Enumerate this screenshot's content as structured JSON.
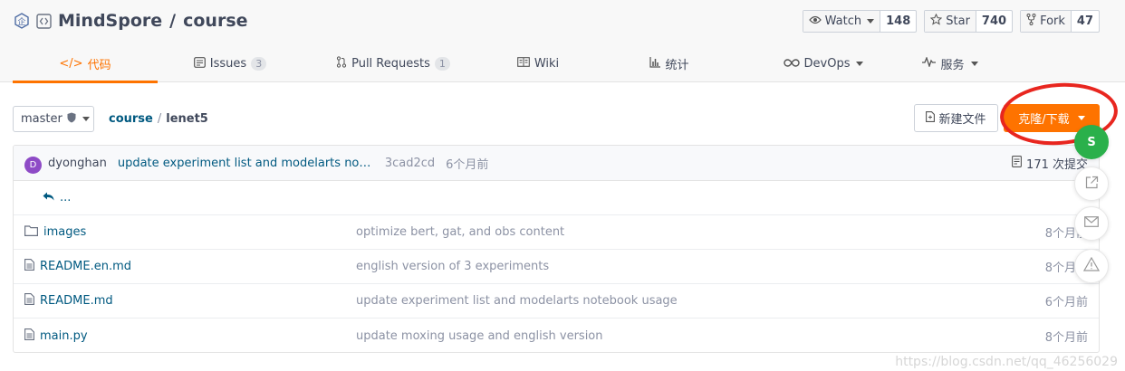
{
  "repo": {
    "owner": "MindSpore",
    "separator": "/",
    "name": "course"
  },
  "actions": {
    "watch": {
      "label": "Watch",
      "count": "148"
    },
    "star": {
      "label": "Star",
      "count": "740"
    },
    "fork": {
      "label": "Fork",
      "count": "47"
    }
  },
  "tabs": [
    {
      "label": "代码",
      "icon": "code-icon",
      "active": true
    },
    {
      "label": "Issues",
      "icon": "issues-icon",
      "badge": "3"
    },
    {
      "label": "Pull Requests",
      "icon": "pull-request-icon",
      "badge": "1"
    },
    {
      "label": "Wiki",
      "icon": "wiki-icon"
    },
    {
      "label": "统计",
      "icon": "stats-icon"
    },
    {
      "label": "DevOps",
      "icon": "devops-icon"
    },
    {
      "label": "服务",
      "icon": "service-icon"
    }
  ],
  "branch": {
    "name": "master"
  },
  "path": {
    "root": "course",
    "separator": "/",
    "current": "lenet5"
  },
  "buttons": {
    "new_file": "新建文件",
    "clone": "克隆/下载"
  },
  "commit": {
    "avatar_letter": "D",
    "author": "dyonghan",
    "message": "update experiment list and modelarts noteb...",
    "sha": "3cad2cd",
    "time": "6个月前",
    "count": "171 次提交"
  },
  "up_dir": "...",
  "files": [
    {
      "type": "folder",
      "name": "images",
      "message": "optimize bert, gat, and obs content",
      "date": "8个月前"
    },
    {
      "type": "file",
      "name": "README.en.md",
      "message": "english version of 3 experiments",
      "date": "8个月前"
    },
    {
      "type": "file",
      "name": "README.md",
      "message": "update experiment list and modelarts notebook usage",
      "date": "6个月前"
    },
    {
      "type": "file",
      "name": "main.py",
      "message": "update moxing usage and english version",
      "date": "8个月前"
    }
  ],
  "floating": {
    "green_letter": "S"
  },
  "watermark": "https://blog.csdn.net/qq_46256029",
  "colors": {
    "accent": "#fe7300",
    "link": "#005980",
    "annotation": "#e8261f",
    "float_green": "#2ab04b"
  }
}
